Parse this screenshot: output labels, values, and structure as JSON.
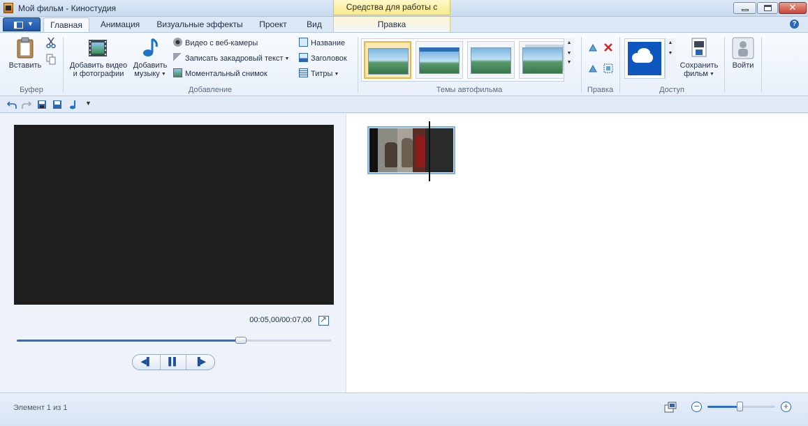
{
  "window": {
    "title": "Мой фильм - Киностудия",
    "context_tab_header": "Средства для работы с видео",
    "close_glyph": "✕"
  },
  "tabs": [
    {
      "label": "Главная"
    },
    {
      "label": "Анимация"
    },
    {
      "label": "Визуальные эффекты"
    },
    {
      "label": "Проект"
    },
    {
      "label": "Вид"
    },
    {
      "label": "Правка"
    }
  ],
  "help_label": "?",
  "ribbon": {
    "clipboard": {
      "paste_label": "Вставить",
      "group_label": "Буфер"
    },
    "add": {
      "add_video_line1": "Добавить видео",
      "add_video_line2": "и фотографии",
      "add_music_line1": "Добавить",
      "add_music_line2": "музыку",
      "webcam_label": "Видео с веб-камеры",
      "narration_label": "Записать закадровый текст",
      "snapshot_label": "Моментальный снимок",
      "title_label": "Название",
      "caption_label": "Заголовок",
      "credits_label": "Титры",
      "group_label": "Добавление"
    },
    "themes": {
      "group_label": "Темы автофильма",
      "selected_index": 0
    },
    "editing": {
      "group_label": "Правка"
    },
    "share": {
      "save_line1": "Сохранить",
      "save_line2": "фильм",
      "group_label": "Доступ"
    },
    "signin_label": "Войти"
  },
  "player": {
    "timecode": "00:05,00/00:07,00",
    "progress_fraction": 0.7143
  },
  "status": {
    "items_text": "Элемент 1 из 1",
    "zoom_fraction": 0.47
  },
  "colors": {
    "accent": "#2d6fc4",
    "preview_bg": "#1e1e1e",
    "context_tab": "#f7e98a"
  }
}
